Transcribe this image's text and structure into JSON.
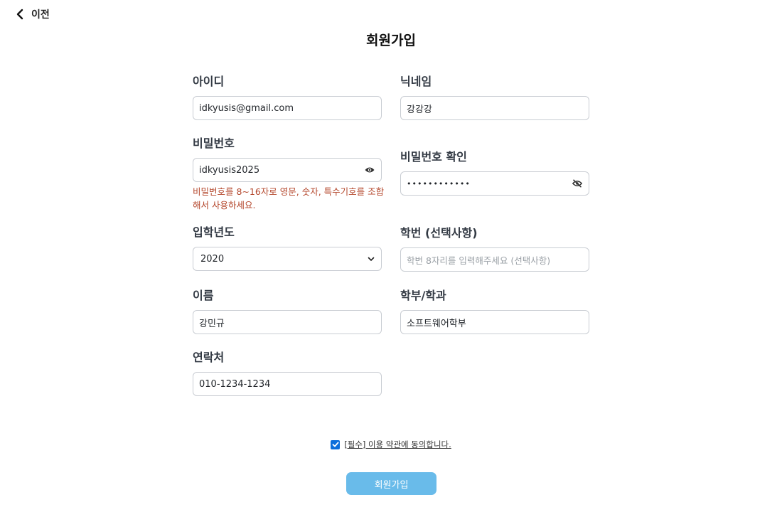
{
  "header": {
    "back_label": "이전",
    "title": "회원가입"
  },
  "fields": {
    "id": {
      "label": "아이디",
      "value": "idkyusis@gmail.com"
    },
    "nickname": {
      "label": "닉네임",
      "value": "강강강"
    },
    "password": {
      "label": "비밀번호",
      "value": "idkyusis2025",
      "error": "비밀번호를 8~16자로 영문, 숫자, 특수기호를 조합해서 사용하세요."
    },
    "password_confirm": {
      "label": "비밀번호 확인",
      "masked_value": "••••••••••••"
    },
    "admission_year": {
      "label": "입학년도",
      "selected": "2020"
    },
    "student_number": {
      "label": "학번 (선택사항)",
      "placeholder": "학번 8자리를 입력해주세요 (선택사항)"
    },
    "name": {
      "label": "이름",
      "value": "강민규"
    },
    "department": {
      "label": "학부/학과",
      "value": "소프트웨어학부"
    },
    "phone": {
      "label": "연락처",
      "value": "010-1234-1234"
    }
  },
  "terms": {
    "label": "[필수] 이용 약관에 동의합니다.",
    "checked": true
  },
  "submit": {
    "label": "회원가입"
  },
  "colors": {
    "accent": "#69bbea",
    "error": "#b4472c",
    "checkbox": "#0b6edb"
  },
  "icons": {
    "back": "chevron-left-icon",
    "show_password": "eye-icon",
    "hide_password": "eye-off-icon",
    "select": "chevron-down-icon"
  }
}
